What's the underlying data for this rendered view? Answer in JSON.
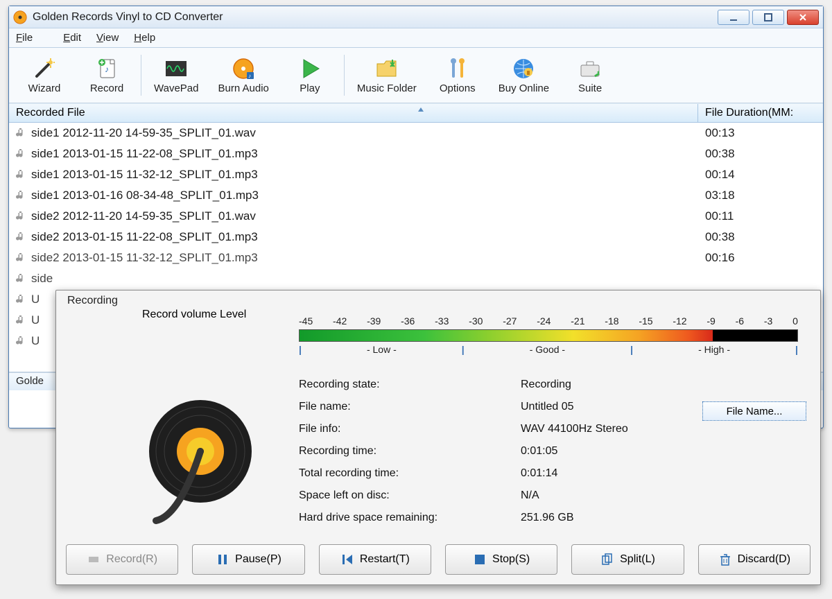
{
  "window": {
    "title": "Golden Records Vinyl to CD Converter"
  },
  "menubar": {
    "file": "File",
    "edit": "Edit",
    "view": "View",
    "help": "Help"
  },
  "toolbar": {
    "wizard": "Wizard",
    "record": "Record",
    "wavepad": "WavePad",
    "burn": "Burn Audio",
    "play": "Play",
    "folder": "Music Folder",
    "options": "Options",
    "buy": "Buy Online",
    "suite": "Suite"
  },
  "list_header": {
    "col1": "Recorded File",
    "col2": "File Duration(MM:"
  },
  "files": [
    {
      "name": "side1 2012-11-20 14-59-35_SPLIT_01.wav",
      "dur": "00:13"
    },
    {
      "name": "side1 2013-01-15 11-22-08_SPLIT_01.mp3",
      "dur": "00:38"
    },
    {
      "name": "side1 2013-01-15 11-32-12_SPLIT_01.mp3",
      "dur": "00:14"
    },
    {
      "name": "side1 2013-01-16 08-34-48_SPLIT_01.mp3",
      "dur": "03:18"
    },
    {
      "name": "side2 2012-11-20 14-59-35_SPLIT_01.wav",
      "dur": "00:11"
    },
    {
      "name": "side2 2013-01-15 11-22-08_SPLIT_01.mp3",
      "dur": "00:38"
    },
    {
      "name": "side2 2013-01-15 11-32-12_SPLIT_01.mp3",
      "dur": "00:16"
    },
    {
      "name": "side",
      "dur": ""
    },
    {
      "name": "U",
      "dur": ""
    },
    {
      "name": "U",
      "dur": ""
    },
    {
      "name": "U",
      "dur": ""
    }
  ],
  "statusbar": {
    "text": "Golde"
  },
  "dialog": {
    "title": "Recording",
    "vol_label": "Record volume Level",
    "ticks": [
      "-45",
      "-42",
      "-39",
      "-36",
      "-33",
      "-30",
      "-27",
      "-24",
      "-21",
      "-18",
      "-15",
      "-12",
      "-9",
      "-6",
      "-3",
      "0"
    ],
    "zone_low": "- Low -",
    "zone_good": "- Good -",
    "zone_high": "- High -",
    "info": {
      "state_l": "Recording state:",
      "state_v": "Recording",
      "name_l": "File name:",
      "name_v": "Untitled 05",
      "info_l": "File info:",
      "info_v": "WAV 44100Hz Stereo",
      "time_l": "Recording time:",
      "time_v": "0:01:05",
      "total_l": "Total recording time:",
      "total_v": "0:01:14",
      "space_l": "Space left on disc:",
      "space_v": "N/A",
      "hd_l": "Hard drive space remaining:",
      "hd_v": "251.96 GB"
    },
    "file_name_btn": "File Name...",
    "buttons": {
      "record": "Record(R)",
      "pause": "Pause(P)",
      "restart": "Restart(T)",
      "stop": "Stop(S)",
      "split": "Split(L)",
      "discard": "Discard(D)"
    }
  }
}
